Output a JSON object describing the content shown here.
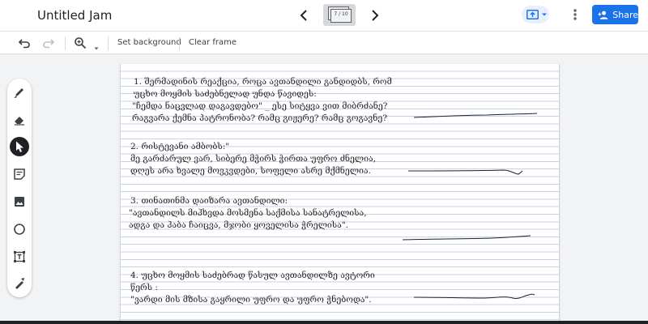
{
  "app": {
    "title": "Untitled Jam"
  },
  "frames": {
    "counter": "7 / 10"
  },
  "header": {
    "share_label": "Share"
  },
  "toolbar": {
    "set_background": "Set background",
    "clear_frame": "Clear frame"
  },
  "questions": [
    {
      "lines": [
        "1. შერმადინის რეაქცია, როცა ავთანდილი განდიდბს, რომ",
        "უცხო მოყმის საძებნელად უნდა წავიდეს:",
        "\"ჩემდა ნაცვლად დაგავდებო\" _ ესე სიტყვა ვით მიბრძანე?",
        "რაგვარა ქემნა პატრონობა? რამც გიჟერე? რამც გოგავნე?"
      ]
    },
    {
      "lines": [
        "2. რისტევანი ამბობს:\"",
        "მე გარძარულ ვარ, სიბერე მჭირს ჭირთა უფრო ძნელია,",
        "დღეს არა ხვალე მოვკვდები, სოფელი ასრე მქმნელია."
      ]
    },
    {
      "lines": [
        "3. თინათინმა დაიზარა ავთანდილი:",
        "\"ავთანდილს მიჰხვდა მოსმენა საქმისა სანატრელისა,",
        "ადგა და ჰაბა ჩაიცვა, მჯობი ყოველისა ჭრელისა\"."
      ]
    },
    {
      "lines": [
        "4. უცხო მოყმის საძებრად წასულ ავთანდილზე ავტორი",
        "წერს :",
        "\"ვარდი მის მზისა გაყრილი უფრო და უფრო ჭნებოდა\"."
      ]
    }
  ],
  "icons": {
    "prev": "chevron-left",
    "next": "chevron-right",
    "send": "cast-to-screen",
    "more": "more-vert",
    "undo": "undo",
    "redo": "redo",
    "zoom": "zoom-in",
    "tools": [
      "pen",
      "eraser",
      "select",
      "sticky-note",
      "image",
      "circle",
      "text-box",
      "laser"
    ]
  },
  "colors": {
    "accent": "#1a73e8",
    "active_tool": "#202124",
    "ruled_line": "#c8d2ec"
  }
}
